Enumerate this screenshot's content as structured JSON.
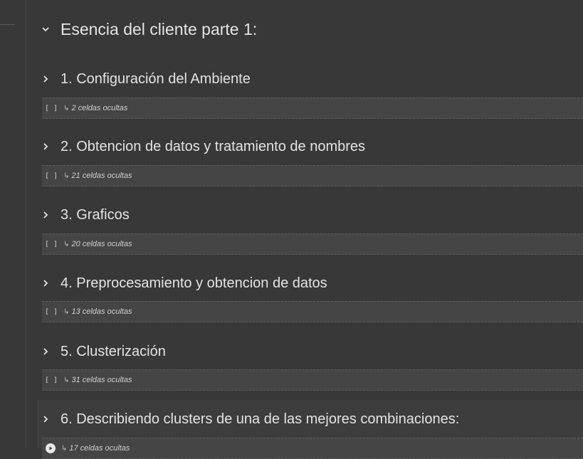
{
  "main_heading": {
    "title": "Esencia del cliente parte 1:",
    "expanded": true
  },
  "sections": [
    {
      "title": "1. Configuración del Ambiente",
      "hidden_cells": "2 celdas ocultas",
      "bracket": "[ ]",
      "arrow": "↳"
    },
    {
      "title": "2. Obtencion de datos y tratamiento de nombres",
      "hidden_cells": "21 celdas ocultas",
      "bracket": "[ ]",
      "arrow": "↳"
    },
    {
      "title": "3. Graficos",
      "hidden_cells": "20 celdas ocultas",
      "bracket": "[ ]",
      "arrow": "↳"
    },
    {
      "title": "4. Preprocesamiento y obtencion de datos",
      "hidden_cells": "13 celdas ocultas",
      "bracket": "[ ]",
      "arrow": "↳"
    },
    {
      "title": "5. Clusterización",
      "hidden_cells": "31 celdas ocultas",
      "bracket": "[ ]",
      "arrow": "↳"
    },
    {
      "title": "6. Describiendo clusters de una de las mejores combinaciones:",
      "hidden_cells": "17 celdas ocultas",
      "arrow": "↳"
    }
  ],
  "colors": {
    "background": "#383838",
    "hidden_bar": "#454545",
    "text": "#e3e3e3"
  },
  "icons": {
    "expanded": "chevron-down-icon",
    "collapsed": "chevron-right-icon",
    "run": "play-icon"
  }
}
